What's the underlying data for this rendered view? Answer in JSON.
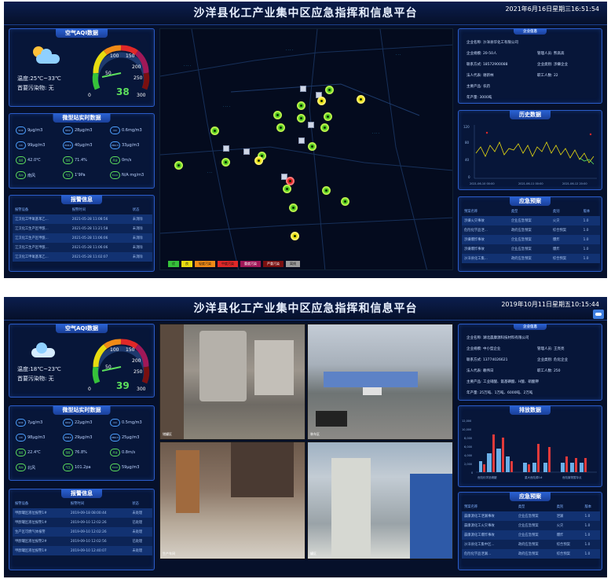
{
  "shot1": {
    "title": "沙洋县化工产业集中区应急指挥和信息平台",
    "datetime": "2021年6月16日星期三16:51:54",
    "aqi": {
      "panel_title": "空气AQI数据",
      "temp_label": "温度:25℃~33℃",
      "pollutant_label": "首要污染物:  无",
      "value": "38",
      "gauge_fraction": 0.13,
      "ticks": [
        "50",
        "100",
        "150",
        "200",
        "250",
        "0",
        "300"
      ]
    },
    "station": {
      "panel_title": "微型站实时数据",
      "items": [
        {
          "icon": "SO2",
          "value": "9μg/m3"
        },
        {
          "icon": "NO2",
          "value": "28μg/m3"
        },
        {
          "icon": "CO",
          "value": "0.6mg/m3"
        },
        {
          "icon": "O3",
          "value": "99μg/m3"
        },
        {
          "icon": "PM10",
          "value": "40μg/m3"
        },
        {
          "icon": "PM2.5",
          "value": "33μg/m3"
        },
        {
          "icon": "温度",
          "value": "42.0℃"
        },
        {
          "icon": "湿度",
          "value": "71.4%"
        },
        {
          "icon": "风速",
          "value": "0m/s"
        },
        {
          "icon": "风向",
          "value": "南风"
        },
        {
          "icon": "气压",
          "value": "1'9Pa"
        },
        {
          "icon": "TVOC",
          "value": "N/A mg/m3"
        }
      ]
    },
    "alarm": {
      "panel_title": "报警信息",
      "headers": [
        "报警设备",
        "报警时间",
        "状态"
      ],
      "rows": [
        [
          "江汉化工甲氧基苯乙...",
          "2021-05-28 11:08:56",
          "未消除"
        ],
        [
          "江汉化工生产区甲酰...",
          "2021-05-28 11:21:58",
          "未消除"
        ],
        [
          "江汉化工生产区甲酰...",
          "2021-05-28 11:06:06",
          "未消除"
        ],
        [
          "江汉化工生产区甲酰...",
          "2021-05-28 11:06:06",
          "未消除"
        ],
        [
          "江汉化工甲氧基苯乙...",
          "2021-05-28 11:02:07",
          "未消除"
        ]
      ]
    },
    "legend": [
      "优",
      "良",
      "轻度污染",
      "中度污染",
      "重度污染",
      "严重污染",
      "离线"
    ],
    "enterprise": {
      "panel_title": "企业信息",
      "name": "企业名称:  沙洋县华化工有限公司",
      "scale": "企业规模:  20-50人",
      "manager": "管理人员:  熊高高",
      "phone": "联系方式:  18572900088",
      "type": "企业类别:  涉嫌企业",
      "legal": "法人代表:  谢新林",
      "staff": "职工人数:  22",
      "product": "主要产品:  农药",
      "output": "年产量:  3000吨"
    },
    "history": {
      "panel_title": "历史数据",
      "xlabels": [
        "2021-06-10 00:00",
        "2021-06-11 00:00",
        "2021-06-12 20:00"
      ],
      "ylabels": [
        "120",
        "80",
        "40",
        "0"
      ]
    },
    "plans": {
      "panel_title": "应急预案",
      "headers": [
        "预案名称",
        "类型",
        "类别",
        "版本"
      ],
      "rows": [
        [
          "涉嫌火灾事故",
          "企业应急预案",
          "火灾",
          "1.0"
        ],
        [
          "危险化学品泄...",
          "政府应急预案",
          "综合预案",
          "1.0"
        ],
        [
          "涉嫌爆炸事故",
          "企业应急预案",
          "爆炸",
          "1.0"
        ],
        [
          "涉嫌爆炸事故",
          "企业应急预案",
          "爆炸",
          "1.0"
        ],
        [
          "沙洋县化工集...",
          "政府应急预案",
          "综合预案",
          "1.0"
        ]
      ]
    }
  },
  "shot2": {
    "title": "沙洋县化工产业集中区应急指挥和信息平台",
    "datetime": "2019年10月11日星期五10:15:44",
    "aqi": {
      "panel_title": "空气AQI数据",
      "temp_label": "温度:18℃~23℃",
      "pollutant_label": "首要污染物:  无",
      "value": "39",
      "gauge_fraction": 0.13,
      "ticks": [
        "50",
        "100",
        "150",
        "200",
        "250",
        "0",
        "300"
      ]
    },
    "station": {
      "panel_title": "微型站实时数据",
      "items": [
        {
          "icon": "SO2",
          "value": "7μg/m3"
        },
        {
          "icon": "NO2",
          "value": "22μg/m3"
        },
        {
          "icon": "CO",
          "value": "0.5mg/m3"
        },
        {
          "icon": "O3",
          "value": "98μg/m3"
        },
        {
          "icon": "PM10",
          "value": "29μg/m3"
        },
        {
          "icon": "PM2.5",
          "value": "25μg/m3"
        },
        {
          "icon": "温度",
          "value": "22.4℃"
        },
        {
          "icon": "湿度",
          "value": "76.8%"
        },
        {
          "icon": "风速",
          "value": "0.8m/s"
        },
        {
          "icon": "风向",
          "value": "北风"
        },
        {
          "icon": "气压",
          "value": "101.2pa"
        },
        {
          "icon": "TVOC",
          "value": "59μg/m3"
        }
      ]
    },
    "alarm": {
      "panel_title": "报警信息",
      "headers": [
        "报警设备",
        "报警时间",
        "状态"
      ],
      "rows": [
        [
          "甲醇罐区液位报警1#",
          "2019-09-18 08:00:44",
          "未处理"
        ],
        [
          "甲醇罐区液位报警1#",
          "2019-09-10 12:02:26",
          "已处理"
        ],
        [
          "生产区可燃气体报警",
          "2019-09-10 12:02:26",
          "未处理"
        ],
        [
          "甲醇罐区液位报警2#",
          "2019-09-10 12:02:56",
          "已处理"
        ],
        [
          "甲醇罐区液位报警1#",
          "2019-09-10 12:40:07",
          "未处理"
        ]
      ]
    },
    "cameras": [
      "储罐区",
      "装车区",
      "生产车间",
      "罐区"
    ],
    "enterprise": {
      "panel_title": "企业信息",
      "name": "企业名称:  湖北晨康源科技材料有限公司",
      "scale": "企业规模:  中小型企业",
      "manager": "管理人员:  王亮亮",
      "phone": "联系方式:  13774026621",
      "type": "企业类别:  危化企业",
      "legal": "法人代表:  赖伟日",
      "staff": "职工人数:  250",
      "product": "主要产品:  工业硝酸、氨基磺酸、H酸、硝酸钾",
      "output": "年产量:  25万吨、1万吨、6000吨、2万吨"
    },
    "emission": {
      "panel_title": "排放数据",
      "xlabels": [
        "危险化学品储罐",
        "重大危险源1#",
        "危险废物暂存点"
      ],
      "ylabels": [
        "12,000",
        "10,000",
        "8,000",
        "6,000",
        "4,000",
        "2,000",
        "0"
      ]
    },
    "plans": {
      "panel_title": "应急预案",
      "headers": [
        "预案名称",
        "类型",
        "类别",
        "版本"
      ],
      "rows": [
        [
          "晨康源化工泄漏事故",
          "企业应急预案",
          "泄漏",
          "1.0"
        ],
        [
          "晨康源化工火灾事故",
          "企业应急预案",
          "火灾",
          "1.0"
        ],
        [
          "晨康源化工爆炸事故",
          "企业应急预案",
          "爆炸",
          "1.0"
        ],
        [
          "沙洋县化工集中区...",
          "政府应急预案",
          "综合预案",
          "1.0"
        ],
        [
          "危险化学品泄漏...",
          "政府应急预案",
          "综合预案",
          "1.0"
        ]
      ]
    }
  }
}
